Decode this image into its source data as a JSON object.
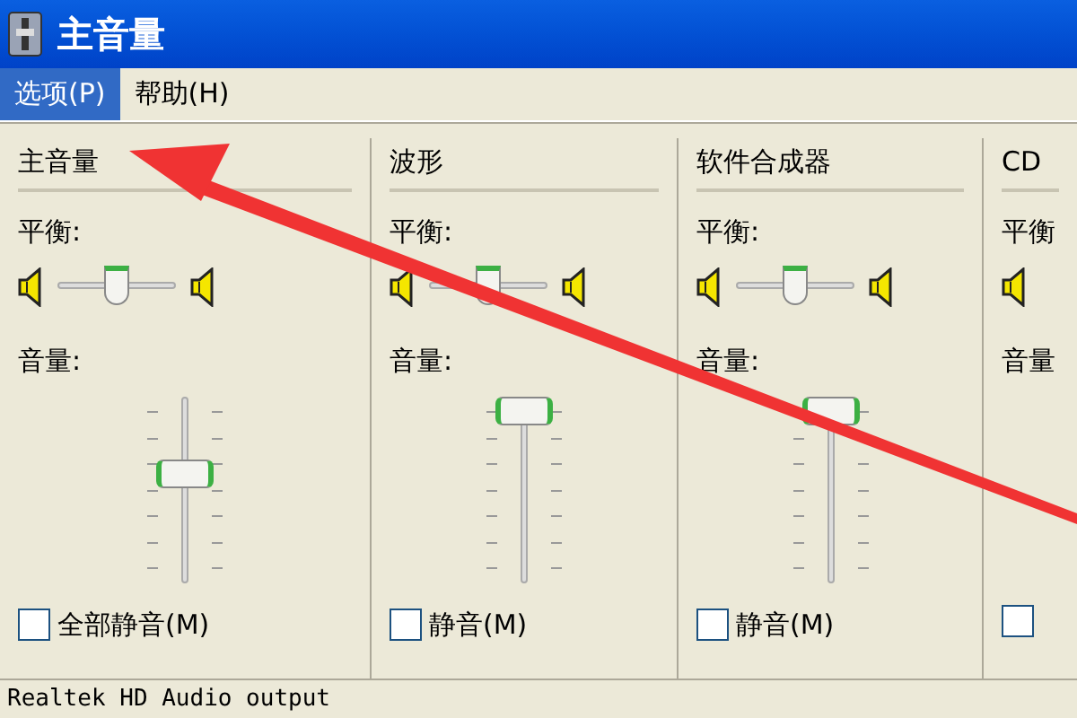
{
  "window": {
    "title": "主音量"
  },
  "menu": [
    {
      "label": "选项(P)",
      "selected": true
    },
    {
      "label": "帮助(H)",
      "selected": false
    }
  ],
  "channels": [
    {
      "header": "主音量",
      "balance_label": "平衡:",
      "balance": {
        "level": 0.5
      },
      "volume_label": "音量:",
      "volume": {
        "level": 0.6
      },
      "mute_label": "全部静音(M)",
      "muted": false
    },
    {
      "header": "波形",
      "balance_label": "平衡:",
      "balance": {
        "level": 0.5
      },
      "volume_label": "音量:",
      "volume": {
        "level": 1.0
      },
      "mute_label": "静音(M)",
      "muted": false
    },
    {
      "header": "软件合成器",
      "balance_label": "平衡:",
      "balance": {
        "level": 0.5
      },
      "volume_label": "音量:",
      "volume": {
        "level": 1.0
      },
      "mute_label": "静音(M)",
      "muted": false
    },
    {
      "header": "CD",
      "balance_label": "平衡",
      "volume_label": "音量",
      "muted": false
    }
  ],
  "status_bar": "Realtek HD Audio output"
}
